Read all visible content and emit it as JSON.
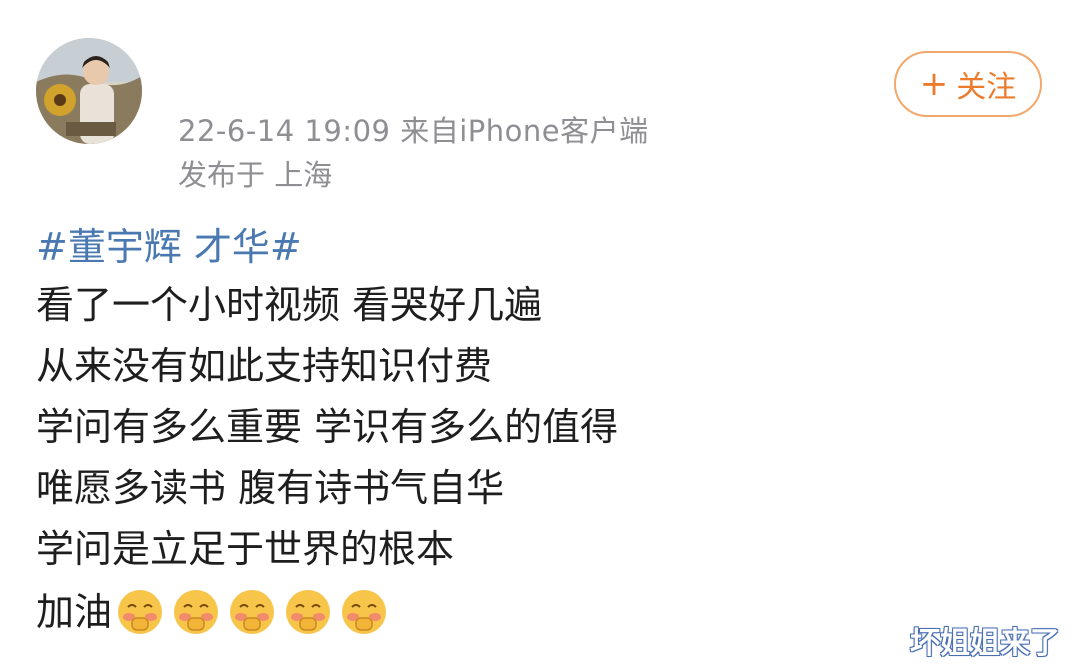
{
  "post": {
    "timestamp_source": "22-6-14 19:09  来自iPhone客户端",
    "location": "发布于 上海",
    "follow_label": "关注",
    "follow_plus": "+",
    "hashtag": "#董宇辉 才华#",
    "lines": [
      "看了一个小时视频 看哭好几遍",
      "从来没有如此支持知识付费",
      "学问有多么重要 学识有多么的值得",
      "唯愿多读书 腹有诗书气自华",
      "学问是立足于世界的根本"
    ],
    "last_line": "加油",
    "emojis": [
      "blushing-face-icon",
      "blushing-face-icon",
      "blushing-face-icon",
      "blushing-face-icon",
      "blushing-face-icon"
    ]
  },
  "watermark": "坏姐姐来了",
  "colors": {
    "meta_text": "#8e8e93",
    "follow_accent": "#ec7c2d",
    "hashtag": "#4a78b0",
    "body_text": "#1e1e1e"
  }
}
